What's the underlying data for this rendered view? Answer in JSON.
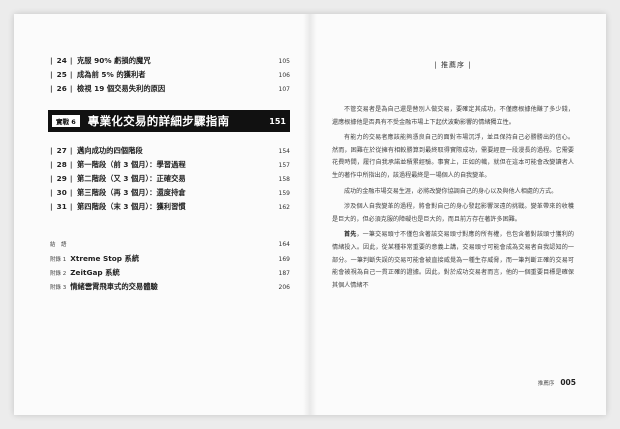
{
  "toc_top": [
    {
      "num": "24",
      "title": "克服 90% 虧損的魔咒",
      "page": "105"
    },
    {
      "num": "25",
      "title": "成為前 5% 的獲利者",
      "page": "106"
    },
    {
      "num": "26",
      "title": "檢視 19 個交易失利的原因",
      "page": "107"
    }
  ],
  "chapter": {
    "tag": "實戰 6",
    "title": "專業化交易的詳細步驟指南",
    "page": "151"
  },
  "toc_chapter": [
    {
      "num": "27",
      "title": "邁向成功的四個階段",
      "page": "154"
    },
    {
      "num": "28",
      "title": "第一階段（前 3 個月）：學習過程",
      "page": "157"
    },
    {
      "num": "29",
      "title": "第二階段（又 3 個月）：正確交易",
      "page": "158"
    },
    {
      "num": "30",
      "title": "第三階段（再 3 個月）：還度持倉",
      "page": "159"
    },
    {
      "num": "31",
      "title": "第四階段（末 3 個月）：獲利習慣",
      "page": "162"
    }
  ],
  "appendix": {
    "conclusion_label": "結　語",
    "conclusion_page": "164",
    "items": [
      {
        "label": "附錄 1",
        "title": "Xtreme Stop 系統",
        "page": "169"
      },
      {
        "label": "附錄 2",
        "title": "ZeitGap 系統",
        "page": "187"
      },
      {
        "label": "附錄 3",
        "title": "情緒雲霄飛車式的交易體驗",
        "page": "206"
      }
    ]
  },
  "right": {
    "heading": "| 推薦序 |",
    "paragraphs": [
      "不管交易者是為自己還是替別人做交易，要確定其成功，不僅應根據他賺了多少錢，還應根據他是否具有不受金融市場上下起伏波動影響的情緒獨立性。",
      "有能力的交易者應該能夠憑良自己的面對市場沉浮，並且保持自己必勝勝出的信心。然而，困難在於從擁有相較勝算到最終取得實際成功，需要經歷一段漫長的過程。它需要花費時間，履行自我承諾並積累經驗。事實上，正如的幟，就但在這本可能會改變讀者人生的著作中所指出的，該過程最終是一場個人的自我變革。",
      "成功的金融市場交易生涯，必將改變你協調自己的身心以及與他人相處的方式。",
      "涉及個人自我變革的過程，將會對自己的身心發起影響深遠的挑戰。變革帶來的收穫是巨大的，但必須克服的障礙也是巨大的，而且前方存在著許多困難。",
      "首先，一筆交易頭寸不僅包含著該交易頭寸對應的所有權，也包含著對該頭寸獲利的情緒投入。因此，從某種非常重要的意義上講，交易頭寸可能會成為交易者自我認知的一部分。一筆判斷失誤的交易可能會被直接威覺為一種生存威脅，而一筆判斷正確的交易可能會被視為自己一貫正確的證據。因此，對於成功交易者而言，他的一個重要目標是確保其個人情緒不"
    ],
    "lead_word": "首先",
    "folio_label": "推薦序",
    "folio_num": "005"
  }
}
